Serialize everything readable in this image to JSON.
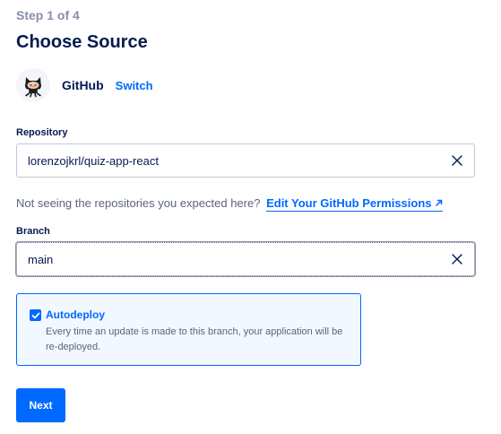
{
  "step_indicator": "Step 1 of 4",
  "page_title": "Choose Source",
  "provider": {
    "name": "GitHub",
    "switch_label": "Switch",
    "icon": "github-octocat-icon"
  },
  "repository": {
    "label": "Repository",
    "value": "lorenzojkrl/quiz-app-react"
  },
  "permissions_hint": {
    "text": "Not seeing the repositories you expected here?",
    "link_label": "Edit Your GitHub Permissions"
  },
  "branch": {
    "label": "Branch",
    "value": "main"
  },
  "autodeploy": {
    "title": "Autodeploy",
    "checked": true,
    "description": "Every time an update is made to this branch, your application will be re-deployed."
  },
  "next_button": "Next",
  "colors": {
    "primary": "#0069ff",
    "text_dark": "#031b4e",
    "text_muted": "#5b6478",
    "step_gray": "#8690a8",
    "autodeploy_bg": "#f2f8ff"
  }
}
